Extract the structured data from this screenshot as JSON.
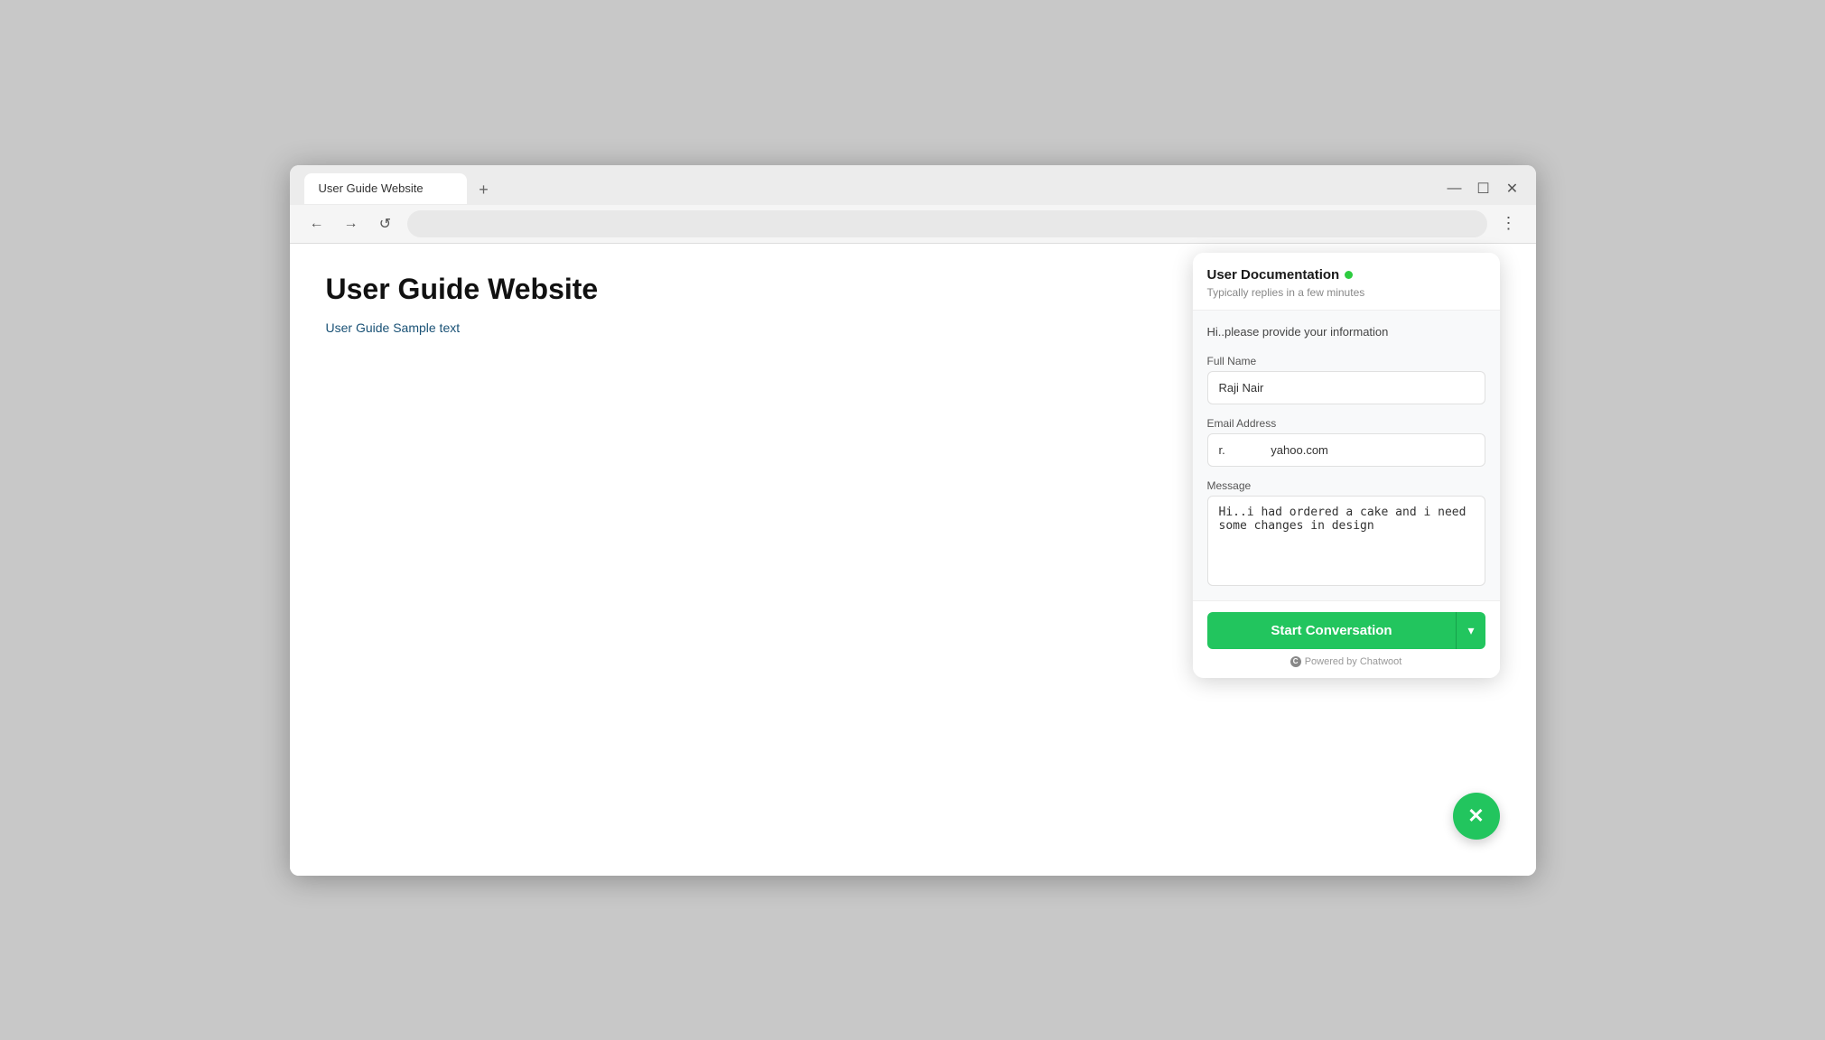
{
  "browser": {
    "tab_label": "User Guide Website",
    "new_tab_icon": "+",
    "back_icon": "←",
    "forward_icon": "→",
    "reload_icon": "↺",
    "address": "",
    "menu_icon": "⋮",
    "minimize_icon": "—",
    "maximize_icon": "☐",
    "close_icon": "✕"
  },
  "page": {
    "title": "User Guide Website",
    "subtitle": "User Guide Sample text"
  },
  "chat_widget": {
    "title": "User Documentation",
    "status": "Typically replies in a few minutes",
    "greeting": "Hi..please provide your information",
    "full_name_label": "Full Name",
    "full_name_value": "Raji Nair",
    "email_label": "Email Address",
    "email_value": "r.              yahoo.com",
    "message_label": "Message",
    "message_value": "Hi..i had ordered a cake and i need some changes in design",
    "start_button_label": "Start Conversation",
    "powered_by": "Powered by Chatwoot"
  },
  "fab": {
    "icon": "✕"
  }
}
